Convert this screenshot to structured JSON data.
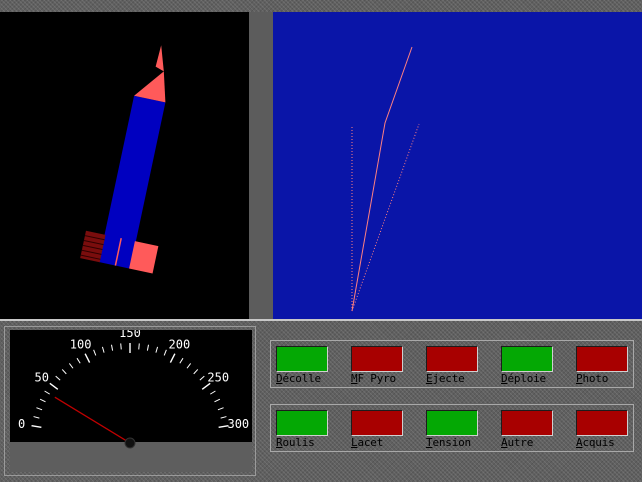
{
  "colors": {
    "screen_bg": "#5a5a5a",
    "rocket_bg": "#000000",
    "trajectory_bg": "#0a15a8",
    "rocket_body": "#0000c0",
    "rocket_tip": "#ff5a5a",
    "lamp_on": "#04a804",
    "lamp_off": "#a80000",
    "needle": "#c00000"
  },
  "rocket": {
    "tilt_deg": 12
  },
  "trajectory": {
    "lines": [
      {
        "style": "solid",
        "color": "#ff8080"
      },
      {
        "style": "dotted",
        "color": "#ff8080",
        "direction": "vertical"
      },
      {
        "style": "dotted",
        "color": "#ff8080",
        "direction": "inclined"
      }
    ]
  },
  "gauge": {
    "min": 0,
    "max": 300,
    "value": 40,
    "tick_labels": [
      "0",
      "50",
      "100",
      "150",
      "200",
      "250",
      "300"
    ],
    "needle_color": "#c00000"
  },
  "panels": [
    {
      "lamps": [
        {
          "label": "Décolle",
          "state": "on"
        },
        {
          "label": "MF Pyro",
          "state": "off"
        },
        {
          "label": "Ejecte",
          "state": "off"
        },
        {
          "label": "Déploie",
          "state": "on"
        },
        {
          "label": "Photo",
          "state": "off"
        }
      ]
    },
    {
      "lamps": [
        {
          "label": "Roulis",
          "state": "on"
        },
        {
          "label": "Lacet",
          "state": "off"
        },
        {
          "label": "Tension",
          "state": "on"
        },
        {
          "label": "Autre",
          "state": "off"
        },
        {
          "label": "Acquis",
          "state": "off"
        }
      ]
    }
  ]
}
